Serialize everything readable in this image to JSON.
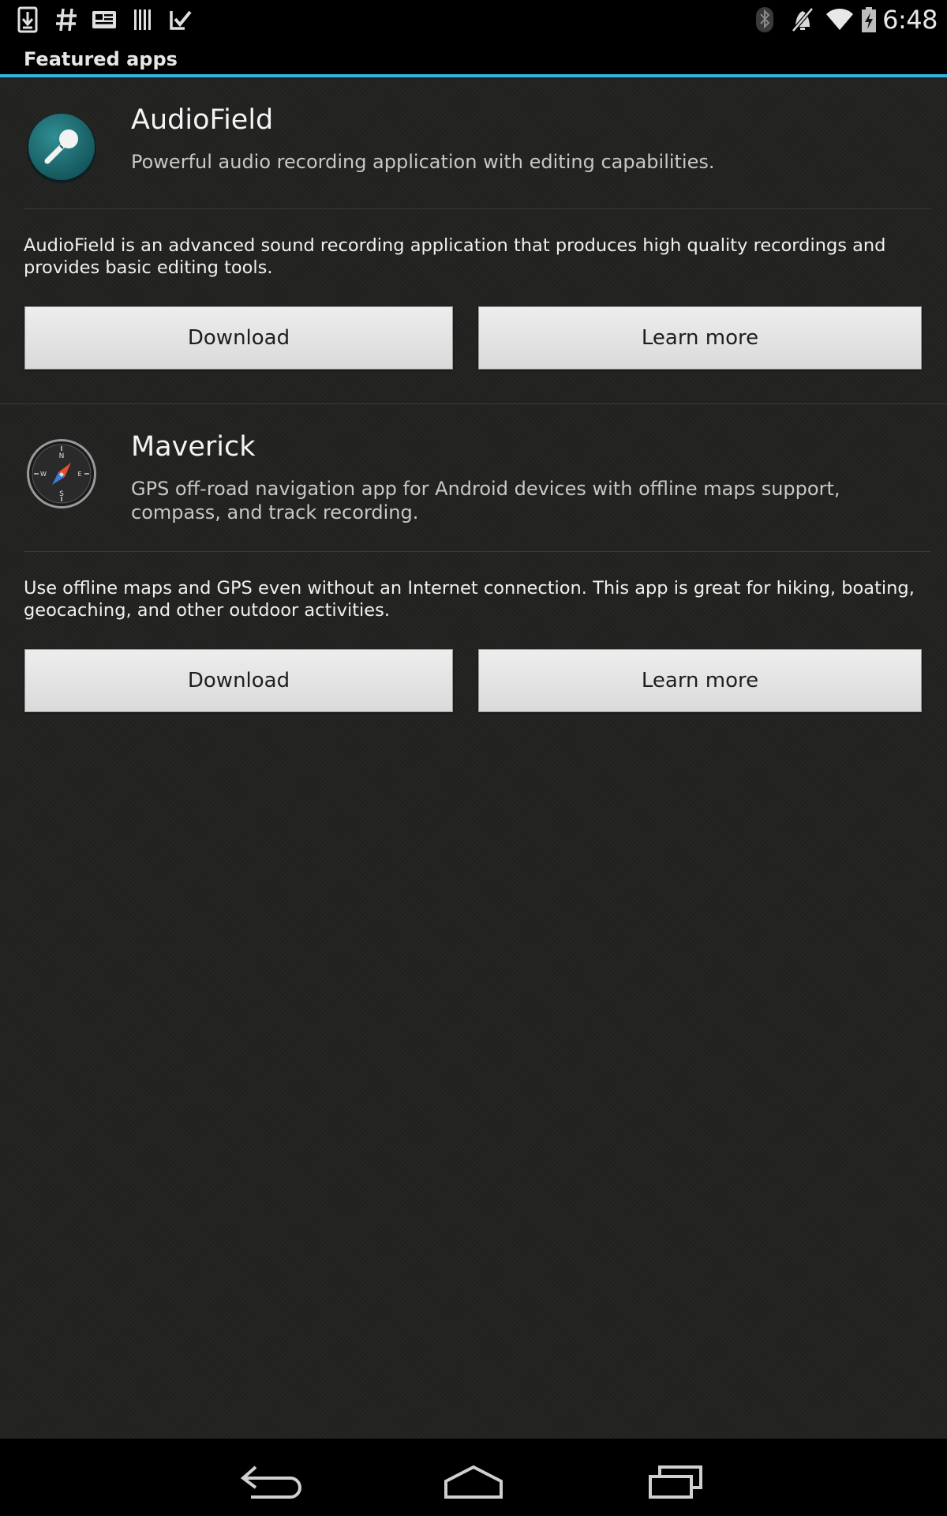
{
  "status_bar": {
    "time": "6:48",
    "left_icons": [
      "download-icon",
      "hash-icon",
      "news-icon",
      "barcode-icon",
      "checkmark-icon"
    ],
    "right_icons": [
      "bluetooth-icon",
      "muted-icon",
      "wifi-icon",
      "battery-charging-icon"
    ]
  },
  "header": {
    "title": "Featured apps",
    "accent_color": "#33b5e5"
  },
  "apps": [
    {
      "name": "AudioField",
      "icon": "microphone-icon",
      "tagline": "Powerful audio recording application with editing capabilities.",
      "description": "AudioField is an advanced sound recording application that produces high quality recordings and provides basic editing tools.",
      "download_label": "Download",
      "learn_more_label": "Learn more"
    },
    {
      "name": "Maverick",
      "icon": "compass-icon",
      "tagline": "GPS off-road navigation app for Android devices with offline maps support, compass, and track recording.",
      "description": "Use offline maps and GPS even without an Internet connection. This app is great for hiking, boating, geocaching, and other outdoor activities.",
      "download_label": "Download",
      "learn_more_label": "Learn more"
    }
  ],
  "nav_bar": {
    "buttons": [
      "back-icon",
      "home-icon",
      "recent-apps-icon"
    ]
  }
}
